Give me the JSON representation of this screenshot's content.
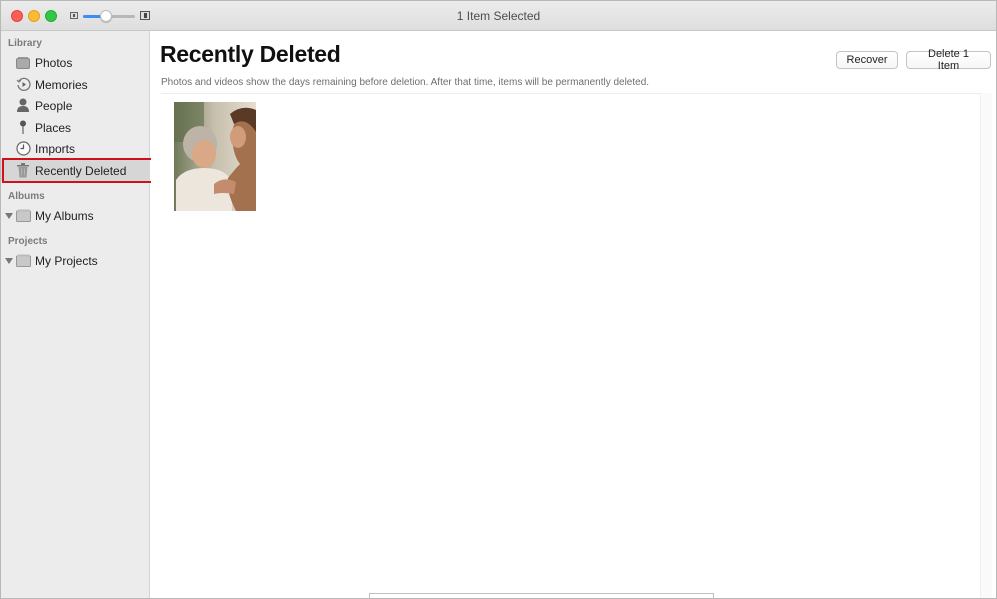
{
  "window": {
    "title": "1 Item Selected",
    "zoom_slider_level": 0.45
  },
  "sidebar": {
    "sections": [
      {
        "label": "Library",
        "items": [
          {
            "label": "Photos",
            "icon": "photos-icon"
          },
          {
            "label": "Memories",
            "icon": "memories-icon"
          },
          {
            "label": "People",
            "icon": "people-icon"
          },
          {
            "label": "Places",
            "icon": "places-icon"
          },
          {
            "label": "Imports",
            "icon": "imports-icon"
          },
          {
            "label": "Recently Deleted",
            "icon": "trash-icon",
            "selected": true
          }
        ]
      },
      {
        "label": "Albums",
        "items": [
          {
            "label": "My Albums",
            "icon": "folder-icon",
            "disclosure": "expanded"
          }
        ]
      },
      {
        "label": "Projects",
        "items": [
          {
            "label": "My Projects",
            "icon": "folder-icon",
            "disclosure": "expanded"
          }
        ]
      }
    ]
  },
  "main": {
    "title": "Recently Deleted",
    "subtitle": "Photos and videos show the days remaining before deletion. After that time, items will be permanently deleted.",
    "buttons": {
      "recover": "Recover",
      "delete": "Delete 1 Item"
    },
    "photos": [
      {
        "description": "Elderly woman smiling with younger woman"
      }
    ]
  },
  "colors": {
    "selection_outline": "#d0111b",
    "accent": "#3a8ef6"
  }
}
